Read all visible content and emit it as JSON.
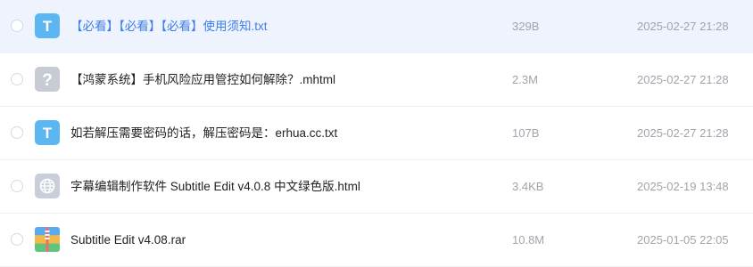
{
  "colors": {
    "selected_row_bg": "#eef3fe",
    "selected_name_color": "#3d7fea",
    "meta_text_color": "#a0a4ab",
    "txt_icon_color": "#5bb6f2",
    "unknown_icon_color": "#c6cbd4",
    "html_icon_color": "#c9cfda"
  },
  "files": [
    {
      "name": "【必看】【必看】【必看】使用须知.txt",
      "size": "329B",
      "date": "2025-02-27 21:28",
      "icon": "txt-file-icon",
      "selected": true
    },
    {
      "name": "【鸿蒙系统】手机风险应用管控如何解除？.mhtml",
      "size": "2.3M",
      "date": "2025-02-27 21:28",
      "icon": "unknown-file-icon",
      "selected": false
    },
    {
      "name": "如若解压需要密码的话，解压密码是：erhua.cc.txt",
      "size": "107B",
      "date": "2025-02-27 21:28",
      "icon": "txt-file-icon",
      "selected": false
    },
    {
      "name": "字幕编辑制作软件 Subtitle Edit v4.0.8 中文绿色版.html",
      "size": "3.4KB",
      "date": "2025-02-19 13:48",
      "icon": "html-file-icon",
      "selected": false
    },
    {
      "name": "Subtitle Edit v4.08.rar",
      "size": "10.8M",
      "date": "2025-01-05 22:05",
      "icon": "rar-archive-icon",
      "selected": false
    }
  ]
}
